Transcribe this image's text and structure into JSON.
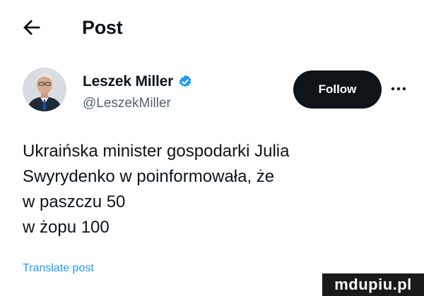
{
  "header": {
    "back_icon": "arrow-left-icon",
    "title": "Post"
  },
  "author": {
    "display_name": "Leszek Miller",
    "verified": true,
    "verified_color": "#1d9bf0",
    "handle": "@LeszekMiller",
    "follow_label": "Follow",
    "more_icon": "more-horizontal-icon"
  },
  "tweet": {
    "lines": [
      "Ukraińska minister gospodarki Julia",
      "Swyrydenko w poinformowała, że",
      "w paszczu 50",
      "w żopu 100"
    ]
  },
  "translate_label": "Translate post",
  "watermark": {
    "text": "mdupiu.pl"
  },
  "colors": {
    "accent": "#1d9bf0",
    "text": "#0f1419",
    "secondary": "#536471",
    "follow_bg": "#0f1419"
  }
}
